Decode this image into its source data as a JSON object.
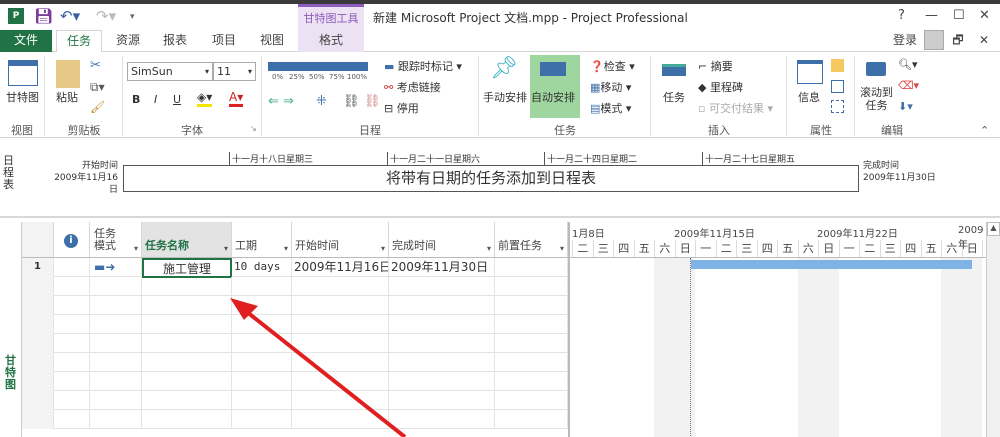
{
  "title_bar": {
    "title": "新建 Microsoft Project 文档.mpp - Project Professional",
    "context_tool": "甘特图工具",
    "help": "?",
    "minimize": "—",
    "maximize": "☐",
    "close": "✕",
    "login": "登录",
    "restore": "🗗",
    "close2": "✕"
  },
  "tabs": [
    "文件",
    "任务",
    "资源",
    "报表",
    "项目",
    "视图",
    "格式"
  ],
  "ribbon": {
    "view": {
      "gantt": "甘特图",
      "group": "视图"
    },
    "clipboard": {
      "paste": "粘贴",
      "group": "剪贴板"
    },
    "font": {
      "name": "SimSun",
      "size": "11",
      "bold": "B",
      "italic": "I",
      "underline": "U",
      "group": "字体"
    },
    "schedule": {
      "percents": [
        "0%",
        "25%",
        "50%",
        "75%",
        "100%"
      ],
      "track": "跟踪时标记",
      "respect_links": "考虑链接",
      "inactivate": "停用",
      "group": "日程"
    },
    "tasks": {
      "manual": "手动安排",
      "auto": "自动安排",
      "inspect": "检查",
      "move": "移动",
      "mode": "模式",
      "group": "任务"
    },
    "insert": {
      "task": "任务",
      "summary": "摘要",
      "milestone": "里程碑",
      "deliverable": "可交付结果",
      "group": "插入"
    },
    "properties": {
      "info": "信息",
      "group": "属性"
    },
    "editing": {
      "scroll": "滚动到",
      "scroll2": "任务",
      "group": "编辑"
    }
  },
  "timeline": {
    "side_label": "日程表",
    "start_label": "开始时间",
    "start_date": "2009年11月16日",
    "finish_label": "完成时间",
    "finish_date": "2009年11月30日",
    "placeholder": "将带有日期的任务添加到日程表",
    "dates": [
      "十一月十八日星期三",
      "十一月二十一日星期六",
      "十一月二十四日星期二",
      "十一月二十七日星期五"
    ]
  },
  "table": {
    "columns": [
      "任务模式",
      "任务名称",
      "工期",
      "开始时间",
      "完成时间",
      "前置任务"
    ],
    "mode_line1": "任务",
    "mode_line2": "模式",
    "rows": [
      {
        "id": "1",
        "name": "施工管理",
        "duration": "10 days",
        "start": "2009年11月16日",
        "finish": "2009年11月30日",
        "pred": ""
      }
    ]
  },
  "gantt": {
    "side_label": "甘特图",
    "weeks": [
      "1月8日",
      "2009年11月15日",
      "2009年11月22日",
      "2009年"
    ],
    "days": [
      "二",
      "三",
      "四",
      "五",
      "六",
      "日",
      "一",
      "二",
      "三",
      "四",
      "五",
      "六",
      "日",
      "一",
      "二",
      "三",
      "四",
      "五",
      "六",
      "日",
      "一"
    ],
    "bar_color": "#7fb2e5"
  }
}
